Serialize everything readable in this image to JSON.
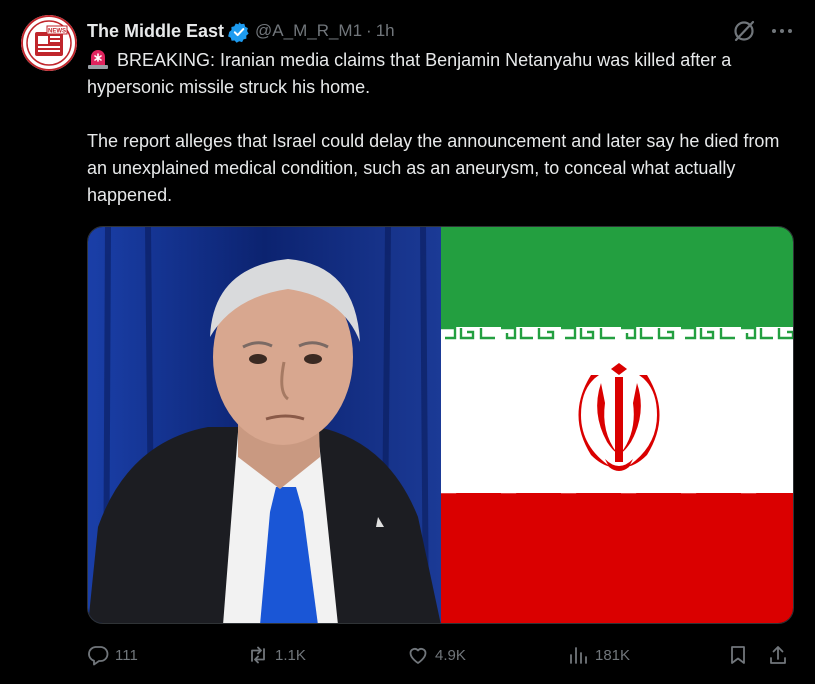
{
  "author": {
    "name": "The Middle East",
    "handle": "@A_M_R_M1",
    "separator": "·",
    "time": "1h",
    "avatar_text": "NEWS"
  },
  "tweet": {
    "line1": "BREAKING: Iranian media claims that Benjamin Netanyahu was killed after a hypersonic missile struck his home.",
    "line2": "The report alleges that Israel could delay the announcement and later say he died from an unexplained medical condition, such as an aneurysm, to conceal what actually happened."
  },
  "actions": {
    "replies": "111",
    "reposts": "1.1K",
    "likes": "4.9K",
    "views": "181K"
  },
  "colors": {
    "background": "#000000",
    "text": "#e7e9ea",
    "muted": "#71767b",
    "verified": "#1d9bf0",
    "flag_green": "#239f40",
    "flag_white": "#ffffff",
    "flag_red": "#da0000"
  },
  "icons": [
    "verified-badge-icon",
    "grok-icon",
    "more-icon",
    "siren-icon",
    "reply-icon",
    "repost-icon",
    "like-icon",
    "views-icon",
    "bookmark-icon",
    "share-icon"
  ]
}
